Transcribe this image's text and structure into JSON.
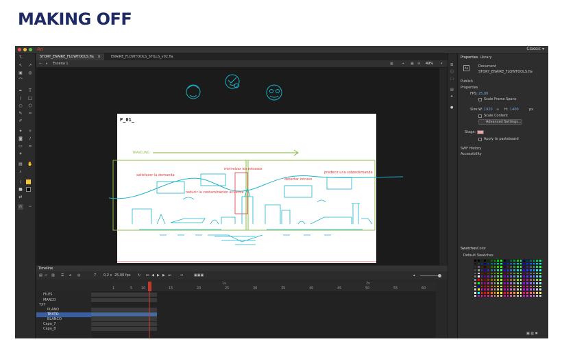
{
  "page": {
    "heading": "MAKING OFF"
  },
  "app": {
    "logo": "An",
    "workspace": "Classic ▾",
    "tabs": [
      {
        "label": "STORY_ENAIRE_FLOWTOOLS.fla"
      },
      {
        "label": "ENAIRE_FLOWTOOLS_STILLS_v02.fla"
      }
    ],
    "tab_close": "×",
    "scene": "Escena 1",
    "zoom": "49%"
  },
  "stage": {
    "panel_id": "P_01_",
    "traveling": "TRAVELING",
    "annotations": [
      "satisfacer la demanda",
      "minimizar los retrasos",
      "detectar intruso",
      "predecir una sobredemanda",
      "reducir la contaminación acústica"
    ]
  },
  "timeline": {
    "title": "Timeline",
    "frame": "7",
    "time": "0,2 s",
    "fps": "25,00 fps",
    "ruler_ticks": [
      "1",
      "5",
      "10",
      "15",
      "20",
      "25",
      "30",
      "35",
      "40",
      "45",
      "50",
      "55",
      "60"
    ],
    "ruler_sec": [
      "1s",
      "2s"
    ],
    "layers": [
      "FILES",
      "MARCO",
      "TXT",
      "PLANO",
      "TEXTO",
      "BLANCO",
      "Capa_7",
      "Capa_8"
    ]
  },
  "properties": {
    "tab_properties": "Properties",
    "tab_library": "Library",
    "type": "Document",
    "doc_name": "STORY_ENAIRE_FLOWTOOLS.fla",
    "publish": "Publish",
    "props": "Properties",
    "fps_label": "FPS:",
    "fps_value": "25,00",
    "scale_spans": "Scale Frame Spans",
    "size_label": "Size:",
    "w_label": "W:",
    "w_value": "1920",
    "h_label": "H:",
    "h_value": "1400",
    "unit": "px",
    "scale_content": "Scale Content",
    "advanced": "Advanced Settings...",
    "stage_label": "Stage:",
    "stage_color": "#f2a3a3",
    "apply_paste": "Apply to pasteboard",
    "swf_history": "SWF History",
    "accessibility": "Accessibility"
  },
  "swatches": {
    "tab_swatches": "Swatches",
    "tab_color": "Color",
    "group": "Default Swatches"
  },
  "colors": {
    "heading": "#1d2a63",
    "annot": "#e23636",
    "sketch": "#1ab3c9",
    "traveling": "#7fb83b"
  }
}
